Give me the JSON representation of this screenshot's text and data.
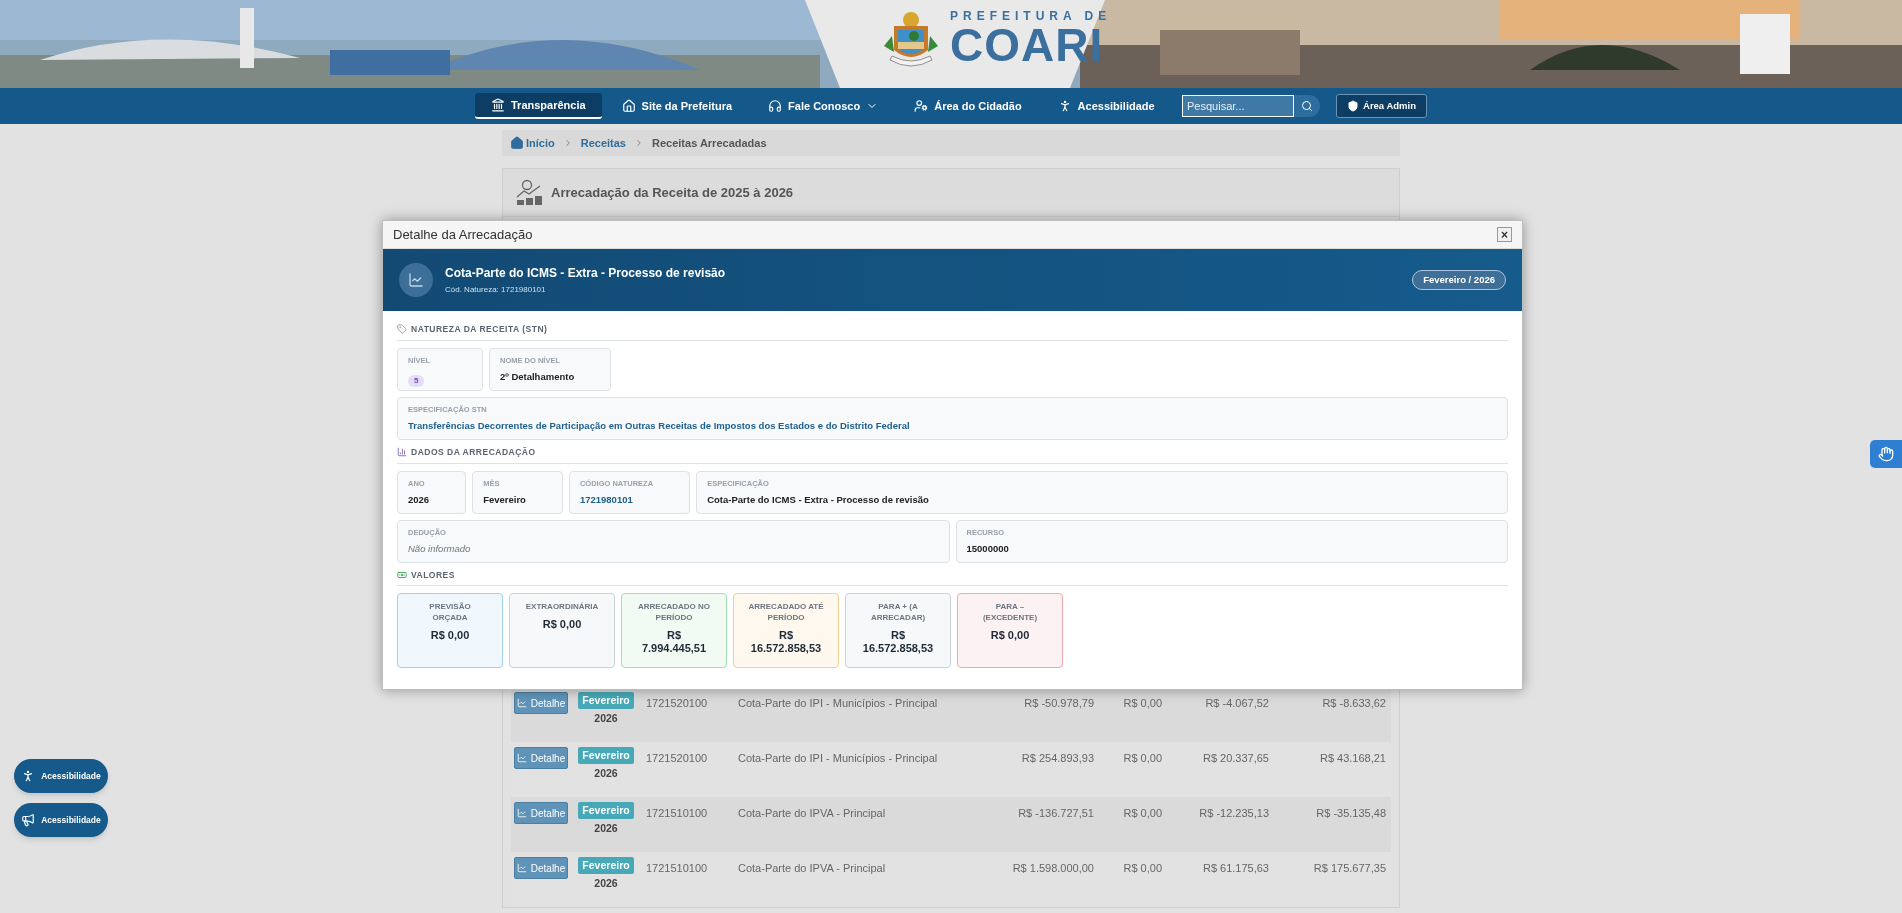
{
  "header": {
    "logo_top": "PREFEITURA DE",
    "logo_main": "COARI"
  },
  "nav": {
    "items": [
      {
        "label": "Transparência",
        "kind": "bank",
        "selected": true,
        "dropdown": false
      },
      {
        "label": "Site da Prefeitura",
        "kind": "home",
        "selected": false,
        "dropdown": false
      },
      {
        "label": "Fale Conosco",
        "kind": "headset",
        "selected": false,
        "dropdown": true
      },
      {
        "label": "Área do Cidadão",
        "kind": "user",
        "selected": false,
        "dropdown": false
      },
      {
        "label": "Acessibilidade",
        "kind": "person",
        "selected": false,
        "dropdown": false
      }
    ],
    "search": {
      "placeholder": "Pesquisar..."
    },
    "admin_button": "Área Admin"
  },
  "breadcrumb": [
    {
      "label": "Início"
    },
    {
      "label": "Receitas"
    },
    {
      "label": "Receitas Arrecadadas"
    }
  ],
  "page_title": "Arrecadação da Receita de 2025 à 2026",
  "modal": {
    "title": "Detalhe da Arrecadação",
    "close": "×",
    "banner": {
      "title": "Cota-Parte do ICMS - Extra - Processo de revisão",
      "subtitle": "Cód. Natureza: 1721980101",
      "badge": "Fevereiro / 2026"
    },
    "sections": [
      {
        "heading": "NATUREZA DA RECEITA (STN)",
        "kind": "tag",
        "rows": [
          [
            {
              "label": "NÍVEL",
              "value": "5",
              "kind": "badge"
            },
            {
              "label": "NOME DO NÍVEL",
              "value": "2º Detalhamento",
              "kind": "text"
            }
          ],
          [
            {
              "label": "ESPECIFICAÇÃO STN",
              "value": "Transferências Decorrentes de Participação em Outras Receitas de Impostos dos Estados e do Distrito Federal",
              "kind": "link"
            }
          ]
        ]
      },
      {
        "heading": "DADOS DA ARRECADAÇÃO",
        "kind": "chart",
        "rows": [
          [
            {
              "label": "ANO",
              "value": "2026",
              "kind": "text"
            },
            {
              "label": "MÊS",
              "value": "Fevereiro",
              "kind": "text"
            },
            {
              "label": "CÓDIGO NATUREZA",
              "value": "1721980101",
              "kind": "link"
            },
            {
              "label": "ESPECIFICAÇÃO",
              "value": "Cota-Parte do ICMS - Extra - Processo de revisão",
              "kind": "text"
            }
          ],
          [
            {
              "label": "DEDUÇÃO",
              "value": "Não informado",
              "kind": "empty"
            },
            {
              "label": "RECURSO",
              "value": "15000000",
              "kind": "text"
            }
          ]
        ]
      }
    ],
    "values_heading": "VALORES",
    "values": [
      {
        "label": "PREVISÃO ORÇADA",
        "value": "R$ 0,00",
        "color": "#9fd0ef"
      },
      {
        "label": "EXTRAORDINÁRIA",
        "value": "R$ 0,00",
        "color": "#c9d2dc"
      },
      {
        "label": "ARRECADADO NO PERÍODO",
        "value": "R$ 7.994.445,51",
        "color": "#9ee0ae"
      },
      {
        "label": "ARRECADADO ATÉ PERÍODO",
        "value": "R$ 16.572.858,53",
        "color": "#f5cf8f"
      },
      {
        "label": "PARA + (A ARRECADAR)",
        "value": "R$ 16.572.858,53",
        "color": "#c9d2dc"
      },
      {
        "label": "PARA – (EXCEDENTE)",
        "value": "R$ 0,00",
        "color": "#f2a9ae"
      }
    ]
  },
  "table": {
    "rows": [
      {
        "button": "Detalhe",
        "month": "Fevereiro",
        "year": "2026",
        "code": "1721520100",
        "description": "Cota-Parte do IPI - Municípios - Principal",
        "values": [
          "R$ -50.978,79",
          "R$ 0,00",
          "R$ -4.067,52",
          "R$ -8.633,62"
        ]
      },
      {
        "button": "Detalhe",
        "month": "Fevereiro",
        "year": "2026",
        "code": "1721520100",
        "description": "Cota-Parte do IPI - Municípios - Principal",
        "values": [
          "R$ 254.893,93",
          "R$ 0,00",
          "R$ 20.337,65",
          "R$ 43.168,21"
        ]
      },
      {
        "button": "Detalhe",
        "month": "Fevereiro",
        "year": "2026",
        "code": "1721510100",
        "description": "Cota-Parte do IPVA - Principal",
        "values": [
          "R$ -136.727,51",
          "R$ 0,00",
          "R$ -12.235,13",
          "R$ -35.135,48"
        ]
      },
      {
        "button": "Detalhe",
        "month": "Fevereiro",
        "year": "2026",
        "code": "1721510100",
        "description": "Cota-Parte do IPVA - Principal",
        "values": [
          "R$ 1.598.000,00",
          "R$ 0,00",
          "R$ 61.175,63",
          "R$ 175.677,35"
        ]
      }
    ]
  },
  "floating_buttons": [
    {
      "label": "Acessibilidade",
      "kind": "person"
    },
    {
      "label": "Acessibilidade",
      "kind": "megaphone"
    }
  ]
}
